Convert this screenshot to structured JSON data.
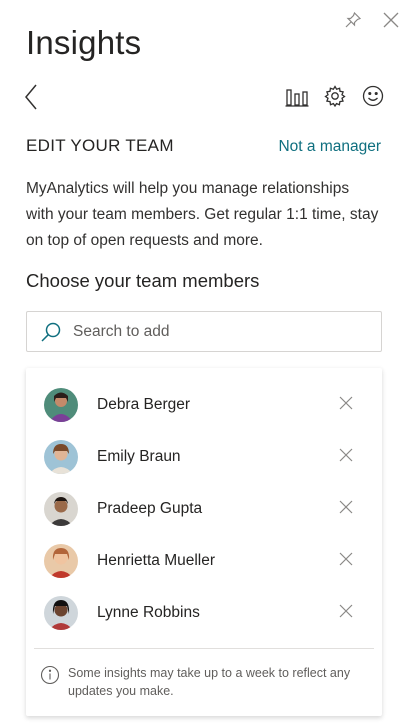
{
  "window": {
    "pin_icon": "pin-icon",
    "close_icon": "close-icon"
  },
  "header": {
    "title": "Insights"
  },
  "nav": {
    "back_icon": "chevron-left-icon",
    "icons": [
      "bar-chart-icon",
      "gear-icon",
      "smiley-icon"
    ]
  },
  "section": {
    "title": "EDIT YOUR TEAM",
    "link": "Not a manager",
    "description": "MyAnalytics will help you manage relationships with your team members. Get regular 1:1 time, stay on top of open requests and more."
  },
  "team": {
    "heading": "Choose your team members",
    "search_placeholder": "Search to add",
    "members": [
      {
        "name": "Debra Berger"
      },
      {
        "name": "Emily Braun"
      },
      {
        "name": "Pradeep Gupta"
      },
      {
        "name": "Henrietta Mueller"
      },
      {
        "name": "Lynne Robbins"
      }
    ],
    "note": "Some insights may take up to a week to reflect any updates you make."
  },
  "colors": {
    "accent": "#0f6f7f",
    "text": "#252423",
    "muted": "#605e5c"
  }
}
